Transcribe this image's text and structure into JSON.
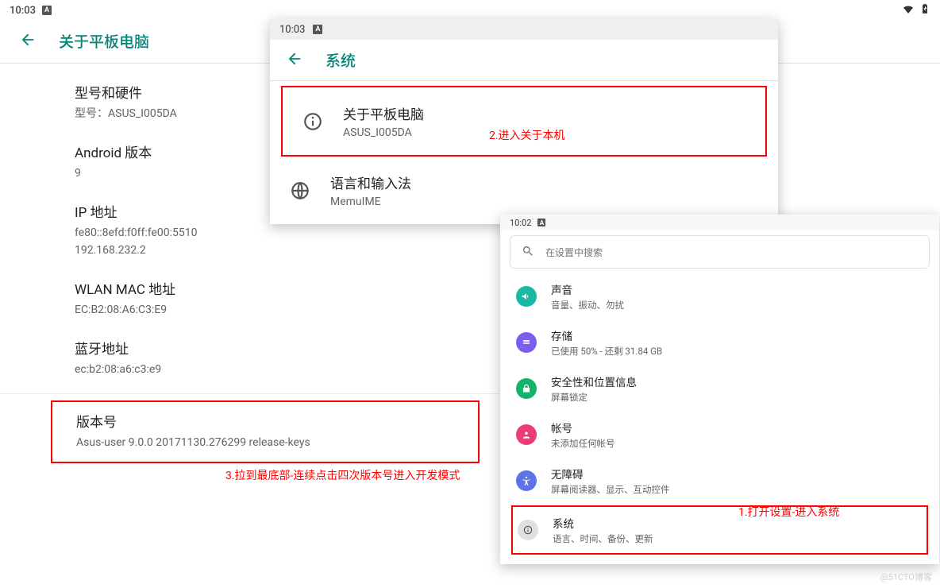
{
  "status_time": "10:03",
  "screen1": {
    "title": "关于平板电脑",
    "items": [
      {
        "title": "型号和硬件",
        "sub": "型号：ASUS_I005DA"
      },
      {
        "title": "Android 版本",
        "sub": "9"
      },
      {
        "title": "IP 地址",
        "sub": "fe80::8efd:f0ff:fe00:5510",
        "sub2": "192.168.232.2"
      },
      {
        "title": "WLAN MAC 地址",
        "sub": "EC:B2:08:A6:C3:E9"
      },
      {
        "title": "蓝牙地址",
        "sub": "ec:b2:08:a6:c3:e9"
      },
      {
        "title": "版本号",
        "sub": "Asus-user 9.0.0 20171130.276299 release-keys"
      }
    ]
  },
  "screen2": {
    "status_time": "10:03",
    "title": "系统",
    "about": {
      "title": "关于平板电脑",
      "sub": "ASUS_I005DA"
    },
    "lang": {
      "title": "语言和输入法",
      "sub": "MemuIME"
    }
  },
  "screen3": {
    "status_time": "10:02",
    "search_placeholder": "在设置中搜索",
    "items": [
      {
        "color": "#1ab8a6",
        "title": "声音",
        "sub": "音量、振动、勿扰"
      },
      {
        "color": "#7b5def",
        "title": "存储",
        "sub": "已使用 50% - 还剩 31.84 GB"
      },
      {
        "color": "#14b36b",
        "title": "安全性和位置信息",
        "sub": "屏幕锁定"
      },
      {
        "color": "#e83d78",
        "title": "帐号",
        "sub": "未添加任何帐号"
      },
      {
        "color": "#5e74e6",
        "title": "无障碍",
        "sub": "屏幕阅读器、显示、互动控件"
      },
      {
        "color": "#9e9e9e",
        "title": "系统",
        "sub": "语言、时间、备份、更新"
      }
    ]
  },
  "annotations": {
    "a1": "1.打开设置-进入系统",
    "a2": "2.进入关于本机",
    "a3": "3.拉到最底部-连续点击四次版本号进入开发模式"
  },
  "watermark": "@51CTO博客"
}
